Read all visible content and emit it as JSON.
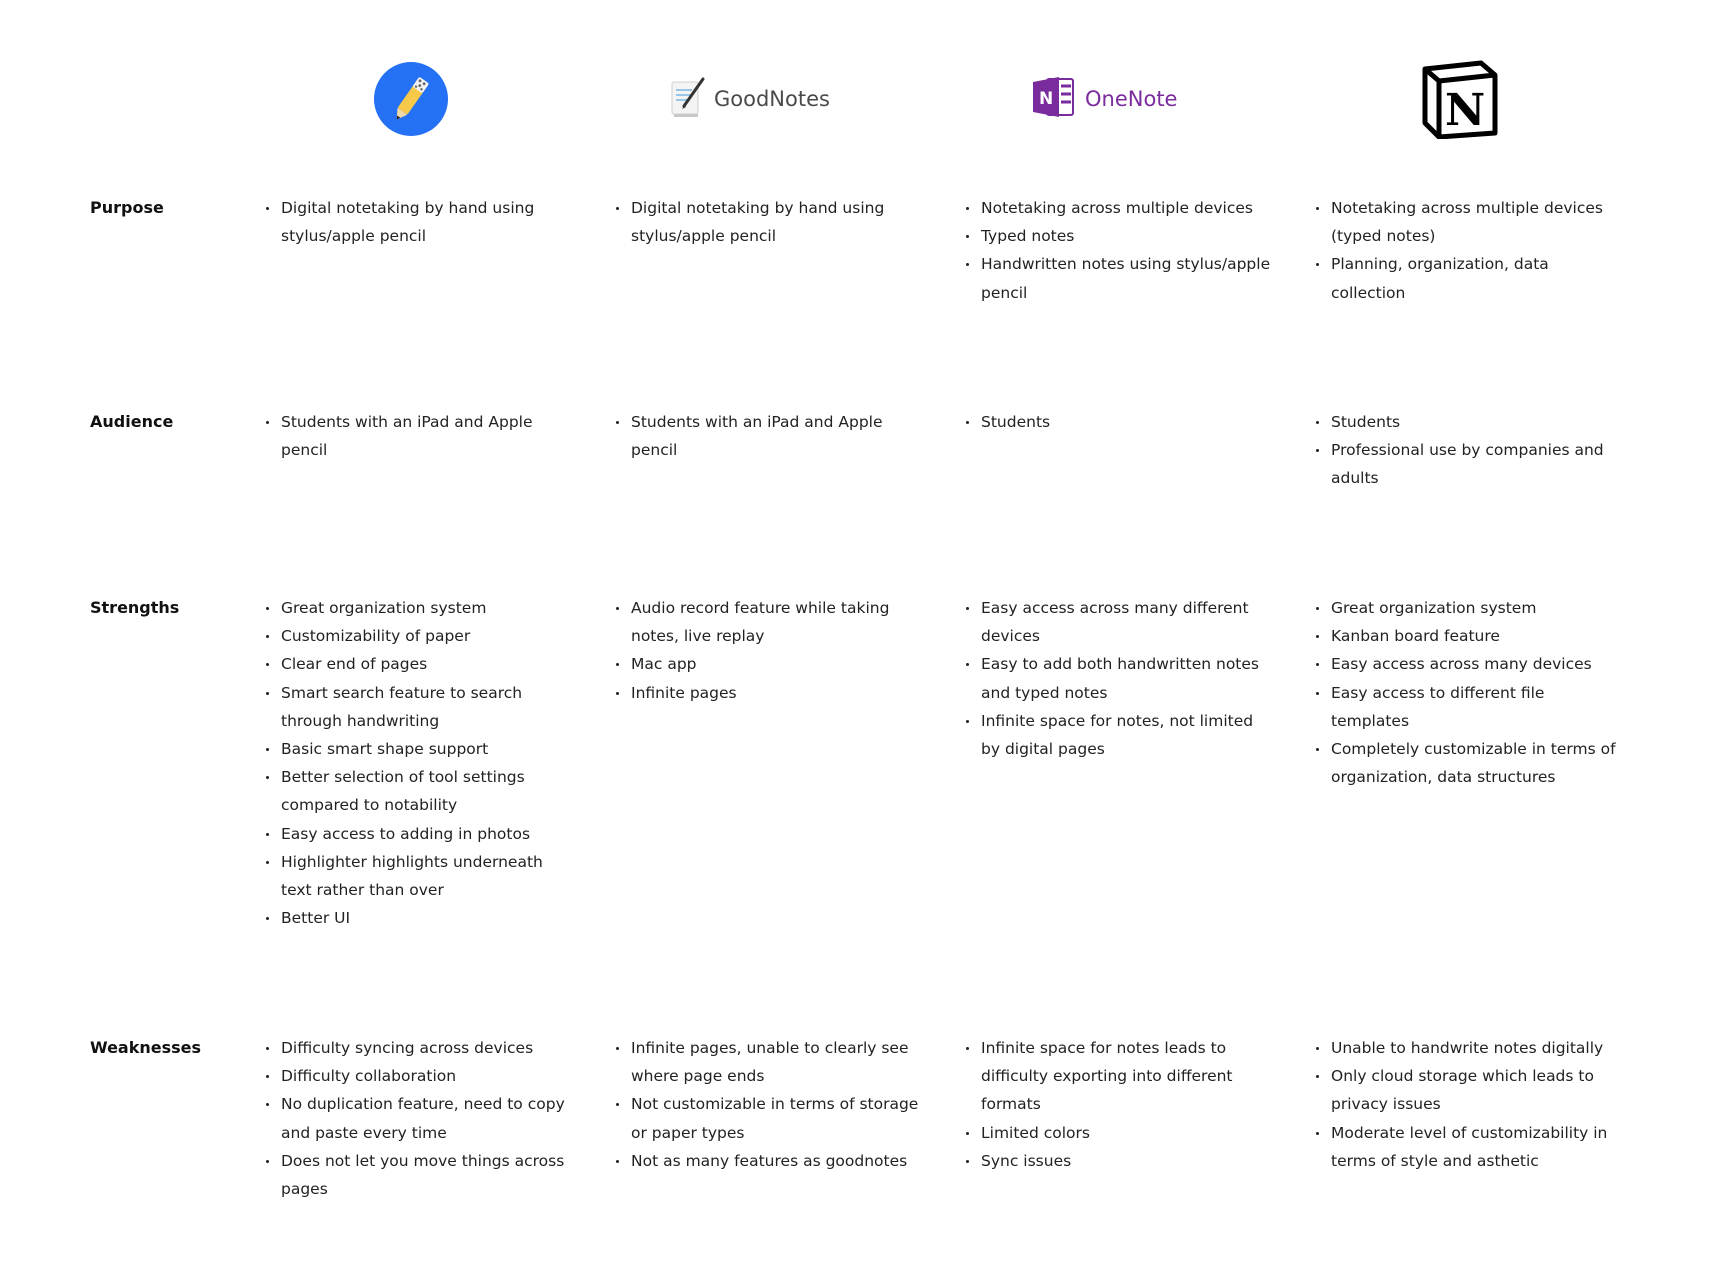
{
  "logos": {
    "notability": {
      "icon": "notability-logo-icon",
      "color": "#2471F5"
    },
    "goodnotes": {
      "icon": "goodnotes-logo-icon",
      "text": "GoodNotes"
    },
    "onenote": {
      "icon": "onenote-logo-icon",
      "text": "OneNote",
      "color": "#7a2c9e"
    },
    "notion": {
      "icon": "notion-logo-icon"
    }
  },
  "rows": [
    {
      "label": "Purpose",
      "columns": [
        [
          "Digital notetaking by hand using stylus/apple pencil"
        ],
        [
          "Digital notetaking by hand using stylus/apple pencil"
        ],
        [
          "Notetaking across multiple devices",
          "Typed notes",
          "Handwritten notes using stylus/apple pencil"
        ],
        [
          "Notetaking across multiple devices (typed notes)",
          "Planning, organization, data collection"
        ]
      ]
    },
    {
      "label": "Audience",
      "columns": [
        [
          "Students with an iPad and Apple pencil"
        ],
        [
          "Students with an iPad and Apple pencil"
        ],
        [
          "Students"
        ],
        [
          "Students",
          "Professional use by companies and adults"
        ]
      ]
    },
    {
      "label": "Strengths",
      "columns": [
        [
          "Great organization system",
          "Customizability of paper",
          "Clear end of pages",
          "Smart search feature to search through handwriting",
          "Basic smart shape support",
          "Better selection of tool settings compared to notability",
          "Easy access to adding in photos",
          "Highlighter highlights underneath text rather than over",
          "Better UI"
        ],
        [
          "Audio record feature while taking notes, live replay",
          "Mac app",
          "Infinite pages"
        ],
        [
          "Easy access across many different devices",
          "Easy to add both handwritten notes and typed notes",
          "Infinite space for notes, not limited by digital pages"
        ],
        [
          "Great organization system",
          "Kanban board feature",
          "Easy access across many devices",
          "Easy access to different file templates",
          "Completely customizable in terms of organization, data structures"
        ]
      ]
    },
    {
      "label": "Weaknesses",
      "columns": [
        [
          "Difficulty syncing across devices",
          "Difficulty collaboration",
          "No duplication feature, need to copy and paste every time",
          "Does not let you move things across pages"
        ],
        [
          "Infinite pages, unable to clearly see where page ends",
          "Not customizable in terms of storage or paper types",
          "Not as many features as goodnotes"
        ],
        [
          "Infinite space for notes leads to difficulty exporting into different formats",
          "Limited colors",
          "Sync issues"
        ],
        [
          "Unable to handwrite notes digitally",
          "Only cloud storage which leads to privacy issues",
          "Moderate level of customizability in terms of style and asthetic"
        ]
      ]
    }
  ]
}
